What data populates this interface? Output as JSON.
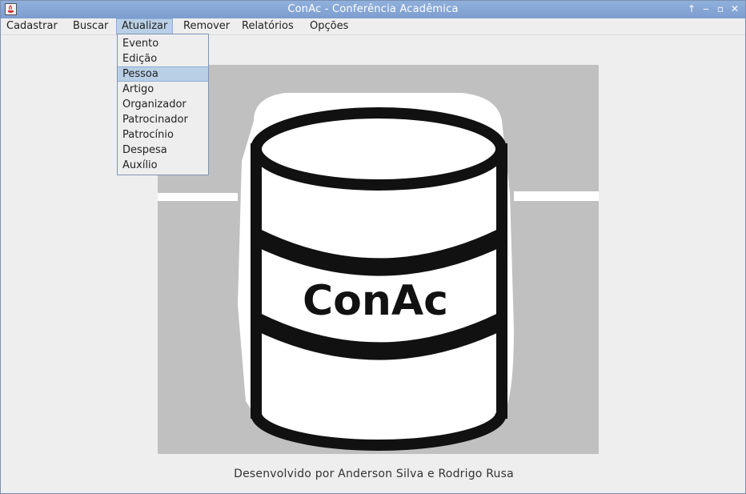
{
  "window": {
    "title": "ConAc - Conferência Acadêmica",
    "controls": [
      "maximize-up",
      "minimize",
      "restore",
      "close"
    ]
  },
  "menubar": {
    "menus": [
      "Cadastrar",
      "Buscar",
      "Atualizar",
      "Remover",
      "Relatórios",
      "Opções"
    ],
    "active_menu": "Atualizar"
  },
  "dropdown": {
    "items": [
      "Evento",
      "Edição",
      "Pessoa",
      "Artigo",
      "Organizador",
      "Patrocinador",
      "Patrocínio",
      "Despesa",
      "Auxílio"
    ],
    "selected": "Pessoa"
  },
  "logo": {
    "text": "ConAc",
    "icon": "database-cylinder-icon"
  },
  "footer": {
    "credit": "Desenvolvido por Anderson Silva e Rodrigo Rusa"
  },
  "colors": {
    "titlebar": "#7c9dcf",
    "highlight": "#b8cfe5",
    "logo_background": "#c0c0c0"
  }
}
